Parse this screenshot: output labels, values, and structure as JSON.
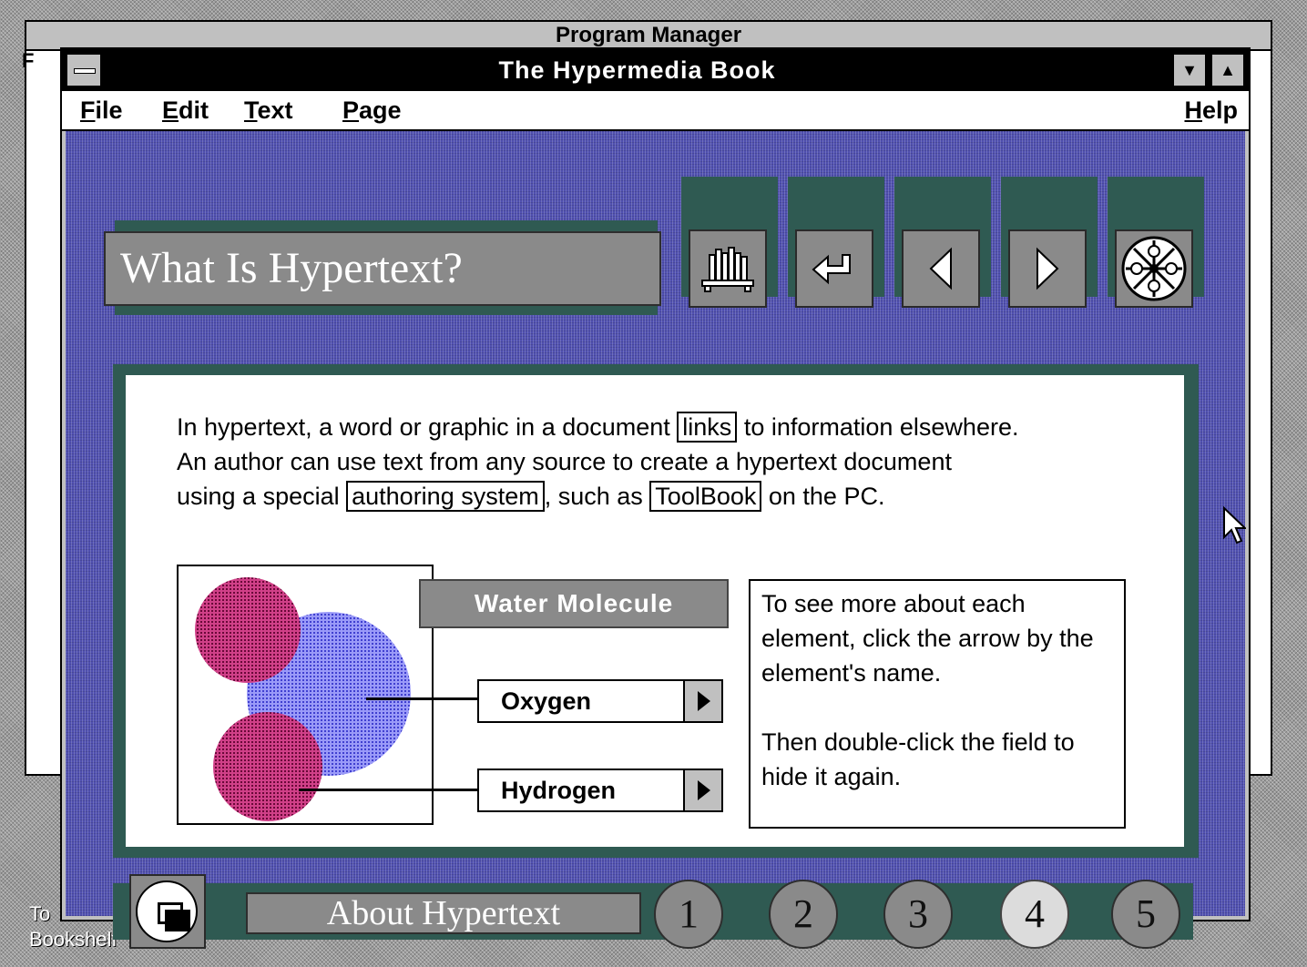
{
  "background_window": {
    "title": "Program Manager",
    "menu_fragment": "F"
  },
  "desktop_icon": {
    "line1": "To",
    "line2": "Bookshelf"
  },
  "window": {
    "title": "The Hypermedia Book",
    "minimize_glyph": "▼",
    "maximize_glyph": "▲"
  },
  "menu": {
    "file": "File",
    "edit": "Edit",
    "text": "Text",
    "page": "Page",
    "help": "Help"
  },
  "page": {
    "title": "What Is Hypertext?",
    "nav_buttons": [
      {
        "name": "bookshelf",
        "icon": "bookshelf-icon"
      },
      {
        "name": "return",
        "icon": "return-arrow-icon"
      },
      {
        "name": "previous-page",
        "icon": "left-triangle-icon"
      },
      {
        "name": "next-page",
        "icon": "right-triangle-icon"
      },
      {
        "name": "film-reel",
        "icon": "film-reel-icon"
      }
    ],
    "intro": {
      "line1_before": "In hypertext, a word or graphic in a document ",
      "link1": "links",
      "line1_after": " to information elsewhere.",
      "line2": "An author can use text from any source to create a hypertext document",
      "line3_before": "using a special ",
      "link2": "authoring system",
      "line3_mid": ", such as ",
      "link3": "ToolBook",
      "line3_after": " on the PC."
    },
    "molecule": {
      "title": "Water Molecule",
      "oxygen_label": "Oxygen",
      "hydrogen_label": "Hydrogen",
      "colors": {
        "hydrogen": "#a0185a",
        "oxygen": "#6c6cf0"
      }
    },
    "info": {
      "para1": "To see more about each element, click the arrow by the element's name.",
      "para2": "Then double-click the field to hide it again."
    },
    "section_label": "About Hypertext",
    "page_numbers": [
      "1",
      "2",
      "3",
      "4",
      "5"
    ],
    "current_page": "4"
  },
  "colors": {
    "page_bg": "#5050b0",
    "panel_green": "#2f5a52",
    "button_gray": "#8a8a8a"
  }
}
